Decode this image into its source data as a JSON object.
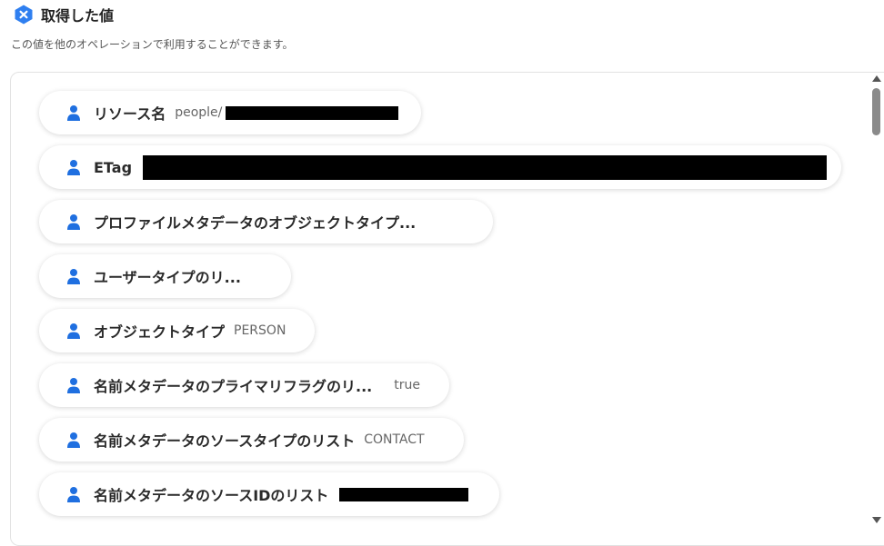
{
  "header": {
    "title": "取得した値",
    "icon": "shield-x-icon",
    "accent": "#2f7ff0"
  },
  "subtitle": "この値を他のオペレーションで利用することができます。",
  "items": [
    {
      "label": "リソース名",
      "value": "people/",
      "redacted": true
    },
    {
      "label": "ETag",
      "value": "",
      "redacted": true
    },
    {
      "label": "プロファイルメタデータのオブジェクトタイプ...",
      "value": "",
      "redacted": false
    },
    {
      "label": "ユーザータイプのリ...",
      "value": "",
      "redacted": false
    },
    {
      "label": "オブジェクトタイプ",
      "value": "PERSON",
      "redacted": false
    },
    {
      "label": "名前メタデータのプライマリフラグのリ...",
      "value": "true",
      "redacted": false
    },
    {
      "label": "名前メタデータのソースタイプのリスト",
      "value": "CONTACT",
      "redacted": false
    },
    {
      "label": "名前メタデータのソースIDのリスト",
      "value": "",
      "redacted": true
    }
  ],
  "icons": {
    "item_icon": "person-icon",
    "person_color": "#1f6fe0"
  }
}
